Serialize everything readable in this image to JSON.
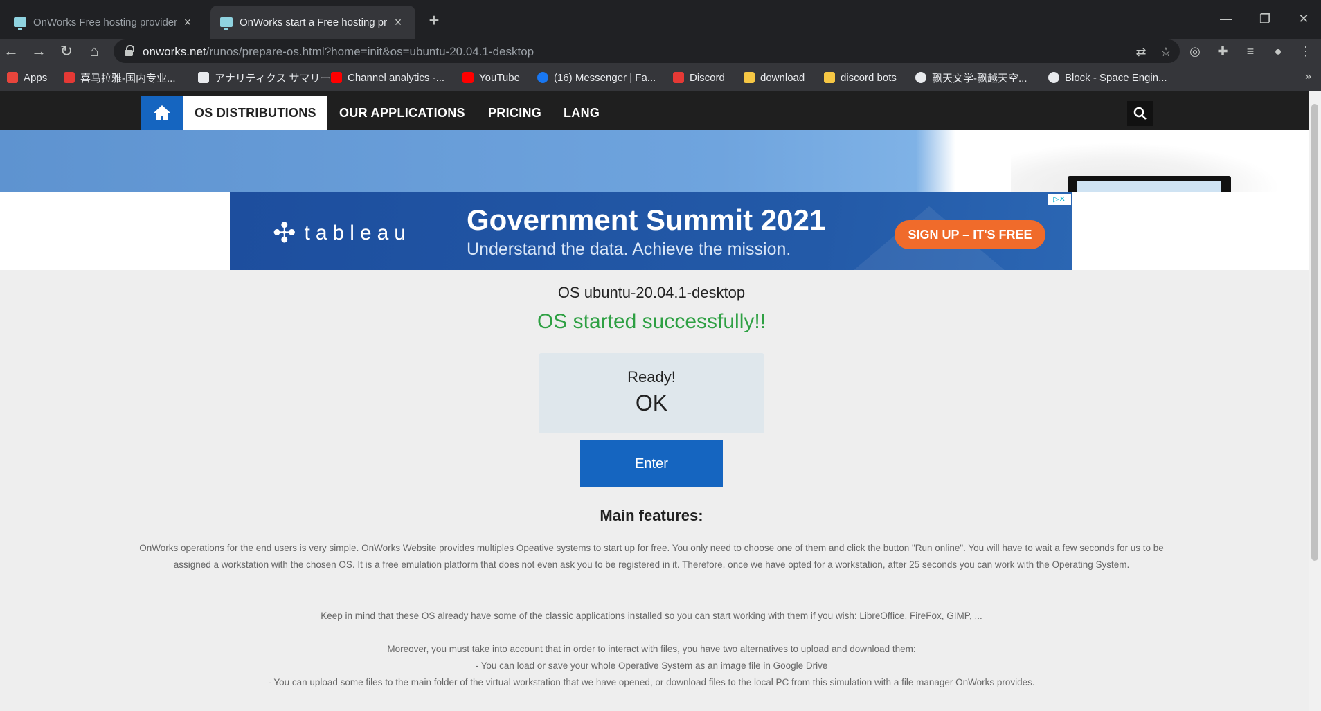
{
  "browser": {
    "tabs": [
      {
        "title": "OnWorks Free hosting provider f",
        "active": false
      },
      {
        "title": "OnWorks start a Free hosting pr",
        "active": true
      }
    ],
    "url_host": "onworks.net",
    "url_path": "/runos/prepare-os.html?home=init&os=ubuntu-20.04.1-desktop",
    "bookmarks": [
      {
        "label": "Apps",
        "color": "#e8453c"
      },
      {
        "label": "喜马拉雅-国内专业...",
        "color": "#e53935"
      },
      {
        "label": "アナリティクス サマリー...",
        "color": "#e8eaed"
      },
      {
        "label": "Channel analytics -...",
        "color": "#ff0000"
      },
      {
        "label": "YouTube",
        "color": "#ff0000"
      },
      {
        "label": "(16) Messenger | Fa...",
        "color": "#1877f2"
      },
      {
        "label": "Discord",
        "color": "#e53935"
      },
      {
        "label": "download",
        "color": "#f6c744"
      },
      {
        "label": "discord bots",
        "color": "#f6c744"
      },
      {
        "label": "飘天文学-飘越天空...",
        "color": "#e8eaed"
      },
      {
        "label": "Block - Space Engin...",
        "color": "#e8eaed"
      }
    ]
  },
  "site": {
    "nav": {
      "items": [
        "OS DISTRIBUTIONS",
        "OUR APPLICATIONS",
        "PRICING",
        "LANG"
      ]
    },
    "ad": {
      "brand": "tableau",
      "headline": "Government Summit 2021",
      "subline": "Understand the data. Achieve the mission.",
      "cta": "SIGN UP – IT'S FREE"
    },
    "os_name": "OS ubuntu-20.04.1-desktop",
    "status": "OS started successfully!!",
    "ready_label": "Ready!",
    "ready_value": "OK",
    "enter_label": "Enter",
    "features_title": "Main features:",
    "paragraphs": [
      "OnWorks operations for the end users is very simple. OnWorks Website provides multiples Opeative systems to start up for free. You only need to choose one of them and click the button \"Run online\". You will have to wait a few seconds for us to be assigned a workstation with the chosen OS. It is a free emulation platform that does not even ask you to be registered in it. Therefore, once we have opted for a workstation, after 25 seconds you can work with the Operating System.",
      "Keep in mind that these OS already have some of the classic applications installed so you can start working with them if you wish: LibreOffice, FireFox, GIMP, ...",
      "Moreover, you must take into account that in order to interact with files, you have two alternatives to upload and download them:",
      "- You can load or save your whole Operative System as an image file in Google Drive",
      "- You can upload some files to the main folder of the virtual workstation that we have opened, or download files to the local PC from this simulation with a file manager OnWorks provides."
    ]
  },
  "colors": {
    "brand_blue": "#1565c0",
    "success_green": "#2ea043",
    "nav_bg": "#1f1f1f"
  }
}
